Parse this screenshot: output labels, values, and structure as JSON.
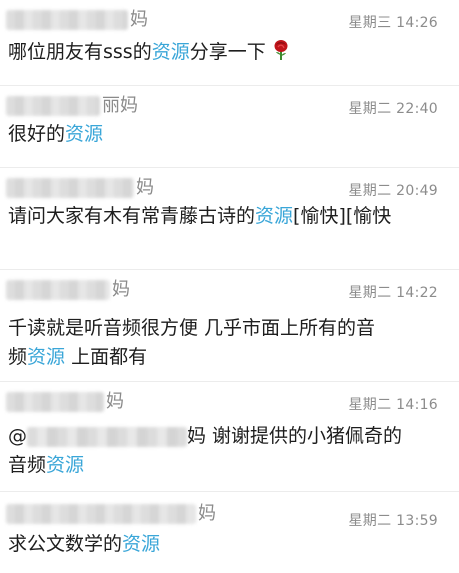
{
  "messages": [
    {
      "name_suffix": "妈",
      "time": "星期三 14:26",
      "pre": "哪位朋友有sss的",
      "link": "资源",
      "post": "分享一下",
      "emoji": "rose-icon"
    },
    {
      "name_suffix": "丽妈",
      "time": "星期二 22:40",
      "pre": "很好的",
      "link": "资源",
      "post": ""
    },
    {
      "name_suffix": "妈",
      "time": "星期二 20:49",
      "pre": "请问大家有木有常青藤古诗的",
      "link": "资源",
      "post": "[愉快][愉快"
    },
    {
      "name_suffix": "妈",
      "time": "星期二 14:22",
      "line1": "千读就是听音频很方便 几乎市面上所有的音",
      "pre": "频",
      "link": "资源",
      "post": " 上面都有"
    },
    {
      "name_suffix": "妈",
      "time": "星期二 14:16",
      "mention_at": "@",
      "mention_tail": "妈 谢谢提供的小猪佩奇的",
      "pre": "音频",
      "link": "资源",
      "post": ""
    },
    {
      "name_suffix": "妈",
      "time": "星期二 13:59",
      "pre": "求公文数学的",
      "link": "资源",
      "post": ""
    }
  ],
  "colors": {
    "link": "#3aa6d8",
    "time": "#8c8c8c",
    "text": "#1e1e1e",
    "divider": "#ececec"
  }
}
